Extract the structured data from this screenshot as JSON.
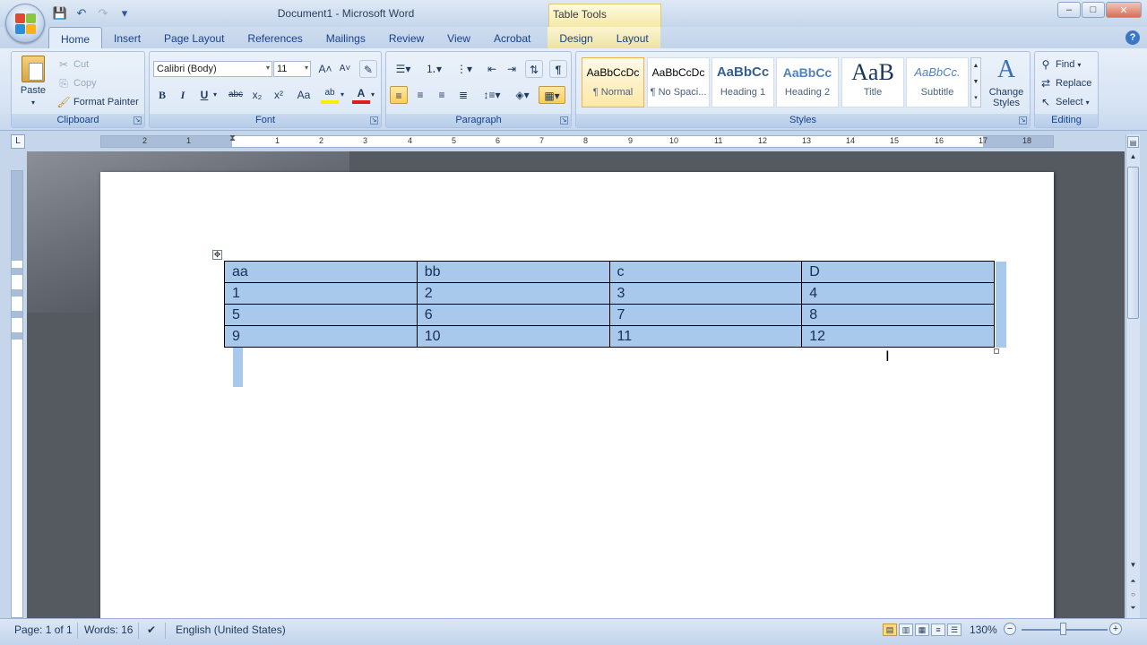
{
  "window": {
    "title": "Document1 - Microsoft Word",
    "context_tab": "Table Tools",
    "controls": {
      "minimize": "–",
      "maximize": "□",
      "close": "✕"
    }
  },
  "quick_access": {
    "save": "💾",
    "undo": "↶",
    "redo": "↷",
    "more": "▾"
  },
  "tabs": [
    "Home",
    "Insert",
    "Page Layout",
    "References",
    "Mailings",
    "Review",
    "View",
    "Acrobat",
    "Design",
    "Layout"
  ],
  "clipboard": {
    "paste": "Paste",
    "cut": "Cut",
    "copy": "Copy",
    "format_painter": "Format Painter",
    "label": "Clipboard"
  },
  "font": {
    "font_name": "Calibri (Body)",
    "font_size": "11",
    "label": "Font",
    "bold": "B",
    "italic": "I",
    "underline": "U",
    "strike": "abc",
    "subscript": "x₂",
    "superscript": "x²",
    "change_case": "Aa",
    "grow": "A˄",
    "shrink": "A˅"
  },
  "paragraph": {
    "label": "Paragraph",
    "show_marks": "¶"
  },
  "styles": {
    "label": "Styles",
    "items": [
      {
        "sample": "AaBbCcDc",
        "name": "¶ Normal"
      },
      {
        "sample": "AaBbCcDc",
        "name": "¶ No Spaci..."
      },
      {
        "sample": "AaBbCс",
        "name": "Heading 1"
      },
      {
        "sample": "AaBbCc",
        "name": "Heading 2"
      },
      {
        "sample": "AaB",
        "name": "Title"
      },
      {
        "sample": "AaBbCc.",
        "name": "Subtitle"
      }
    ],
    "change_styles": "Change Styles"
  },
  "editing": {
    "label": "Editing",
    "find": "Find",
    "replace": "Replace",
    "select": "Select"
  },
  "document": {
    "table": [
      [
        "aa",
        "bb",
        "c",
        "D"
      ],
      [
        "1",
        "2",
        "3",
        "4"
      ],
      [
        "5",
        "6",
        "7",
        "8"
      ],
      [
        "9",
        "10",
        "11",
        "12"
      ]
    ]
  },
  "status": {
    "page": "Page: 1 of 1",
    "words": "Words: 16",
    "language": "English (United States)",
    "zoom": "130%"
  },
  "ruler_numbers": [
    "2",
    "1",
    "1",
    "2",
    "3",
    "4",
    "5",
    "6",
    "7",
    "8",
    "9",
    "10",
    "11",
    "12",
    "13",
    "14",
    "15",
    "16",
    "17",
    "18"
  ]
}
